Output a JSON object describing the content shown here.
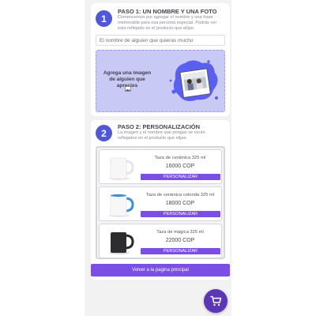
{
  "step1": {
    "number": "1",
    "title": "PASO 1: UN NOMBRE Y UNA FOTO",
    "description": "Comencemos por agregar el nombre y una frase memorable para esa persona especial. Podrás ver esto reflejado en el producto que elijas.",
    "name_placeholder": "El nombre de alguien que quieras mucho",
    "upload_label": "Agrega una imagen de alguien que aprecies"
  },
  "step2": {
    "number": "2",
    "title": "PASO 2: PERSONALIZACIÓN",
    "description": "La imagen y el nombre que pongas se verán reflejados en el producto que elijas."
  },
  "products": [
    {
      "name": "Taza de cerámica 325 ml",
      "price": "16000 COP",
      "button": "PERSONALIZAR"
    },
    {
      "name": "Taza de cerámica colorida 325 ml",
      "price": "18000 COP",
      "button": "PERSONALIZAR"
    },
    {
      "name": "Taza de mágica 325 ml",
      "price": "22000 COP",
      "button": "PERSONALIZAR"
    }
  ],
  "back_button": "Volver a la pagina principal",
  "colors": {
    "accent": "#7b4ee6",
    "step_circle": "#5058d6",
    "upload_bg": "#c8c9f4",
    "fab": "#5b36b5"
  },
  "icons": [
    "image-upload-icon",
    "photo-illustration",
    "mug-white-icon",
    "mug-blue-handle-icon",
    "mug-black-icon",
    "cart-icon"
  ]
}
